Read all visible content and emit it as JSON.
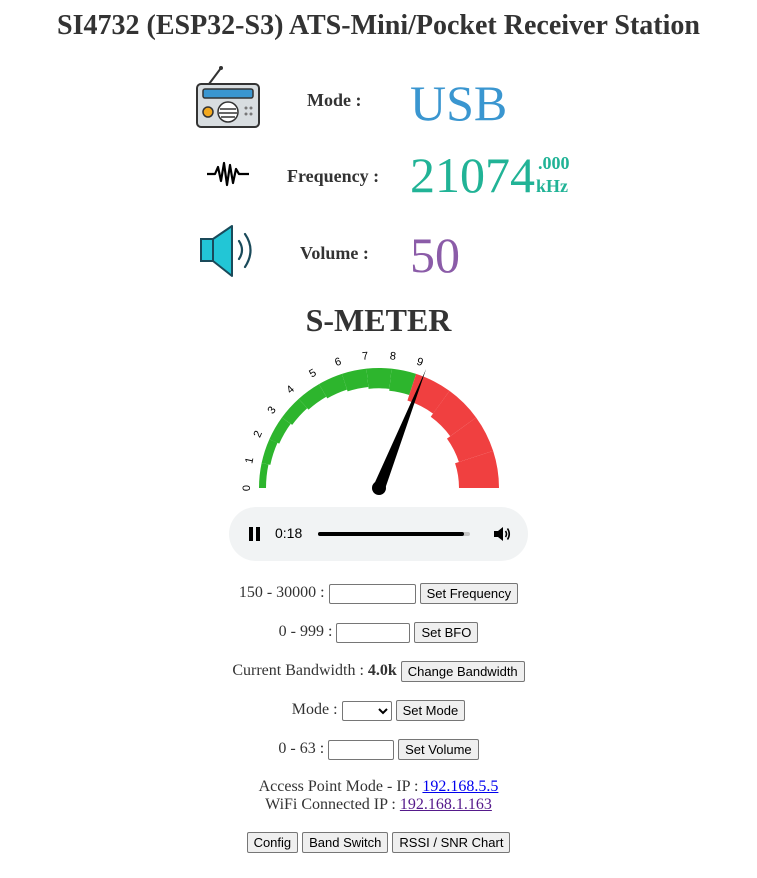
{
  "page": {
    "title": "SI4732 (ESP32-S3) ATS-Mini/Pocket Receiver Station"
  },
  "status": {
    "mode_label": "Mode :",
    "mode_value": "USB",
    "frequency_label": "Frequency :",
    "frequency_main": "21074",
    "frequency_decimal": ".000",
    "frequency_unit": "kHz",
    "volume_label": "Volume :",
    "volume_value": "50"
  },
  "colors": {
    "mode": "#3a96d0",
    "frequency": "#21b396",
    "volume": "#8b5ca8",
    "smeter_green": "#2db52d",
    "smeter_red": "#f04040",
    "needle": "#000000"
  },
  "smeter": {
    "title": "S-METER",
    "ticks": [
      "0",
      "1",
      "2",
      "3",
      "4",
      "5",
      "6",
      "7",
      "8",
      "9"
    ],
    "needle_value": 9.3,
    "max_value": 15
  },
  "audio": {
    "time": "0:18",
    "progress_fraction": 0.96
  },
  "controls": {
    "frequency_range": "150 - 30000 :",
    "frequency_input": "",
    "set_frequency": "Set Frequency",
    "bfo_range": "0 - 999 :",
    "bfo_input": "",
    "set_bfo": "Set BFO",
    "bandwidth_prefix": "Current Bandwidth :",
    "bandwidth_value": "4.0k",
    "change_bandwidth": "Change Bandwidth",
    "mode_prefix": "Mode :",
    "mode_selected": "",
    "set_mode": "Set Mode",
    "volume_range": "0 - 63 :",
    "volume_input": "",
    "set_volume": "Set Volume"
  },
  "network": {
    "ap_label": "Access Point Mode - IP :",
    "ap_ip": "192.168.5.5",
    "wifi_label": "WiFi Connected IP :",
    "wifi_ip": "192.168.1.163"
  },
  "buttons": {
    "config": "Config",
    "band_switch": "Band Switch",
    "rssi_chart": "RSSI / SNR Chart"
  }
}
